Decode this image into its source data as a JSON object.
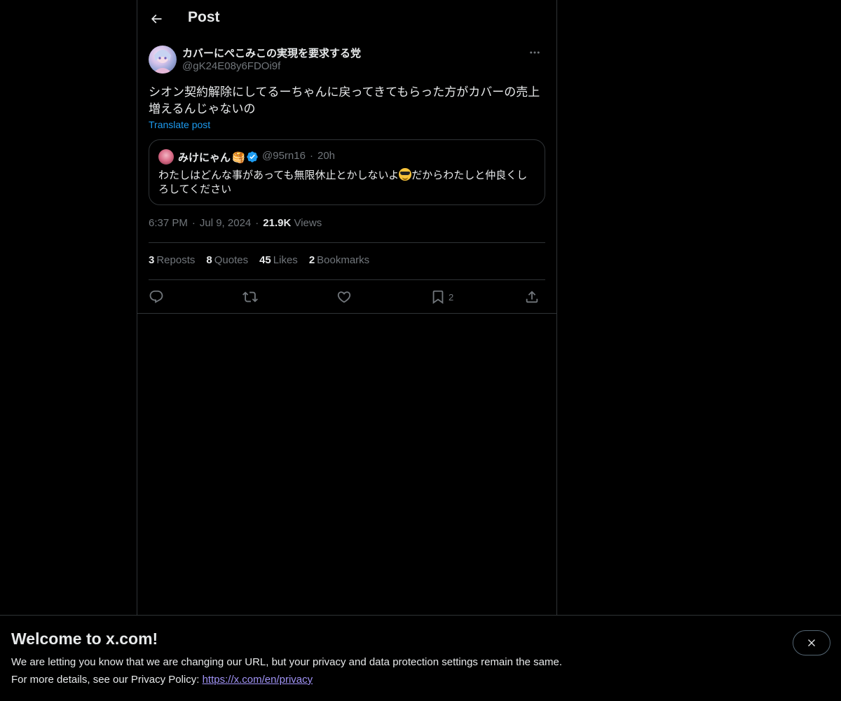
{
  "header": {
    "title": "Post"
  },
  "post": {
    "author_name": "カバーにぺこみこの実現を要求する党",
    "author_handle": "@gK24E08y6FDOi9f",
    "text_line1": "シオン契約解除にしてるーちゃんに戻ってきてもらった方がカバーの売上",
    "text_line2": "増えるんじゃないの",
    "translate_label": "Translate post",
    "time": "6:37 PM",
    "date": "Jul 9, 2024",
    "views_count": "21.9K",
    "views_label": "Views"
  },
  "quote": {
    "name": "みけにゃん",
    "name_emoji": "🥞",
    "handle": "@95rn16",
    "separator": "·",
    "time": "20h",
    "text_before_emoji": "わたしはどんな事があっても無限休止とかしないよ",
    "text_after_emoji": "だからわたしと仲良くし",
    "text_line2": "ろしてください"
  },
  "stats": {
    "reposts_count": "3",
    "reposts_label": "Reposts",
    "quotes_count": "8",
    "quotes_label": "Quotes",
    "likes_count": "45",
    "likes_label": "Likes",
    "bookmarks_count": "2",
    "bookmarks_label": "Bookmarks"
  },
  "actions": {
    "bookmark_count": "2"
  },
  "banner": {
    "title": "Welcome to x.com!",
    "line1": "We are letting you know that we are changing our URL, but your privacy and data protection settings remain the same.",
    "line2_prefix": "For more details, see our Privacy Policy: ",
    "link_text": "https://x.com/en/privacy"
  },
  "colors": {
    "background": "#000000",
    "text": "#e7e9ea",
    "secondary": "#71767b",
    "accent": "#1d9bf0",
    "border": "#2f3336",
    "link": "#a093f5"
  },
  "icons": {
    "back": "arrow-left-icon",
    "more": "ellipsis-icon",
    "verified": "verified-badge-icon",
    "reply": "reply-icon",
    "repost": "repost-icon",
    "like": "heart-icon",
    "bookmark": "bookmark-icon",
    "share": "share-icon",
    "close": "close-icon"
  }
}
